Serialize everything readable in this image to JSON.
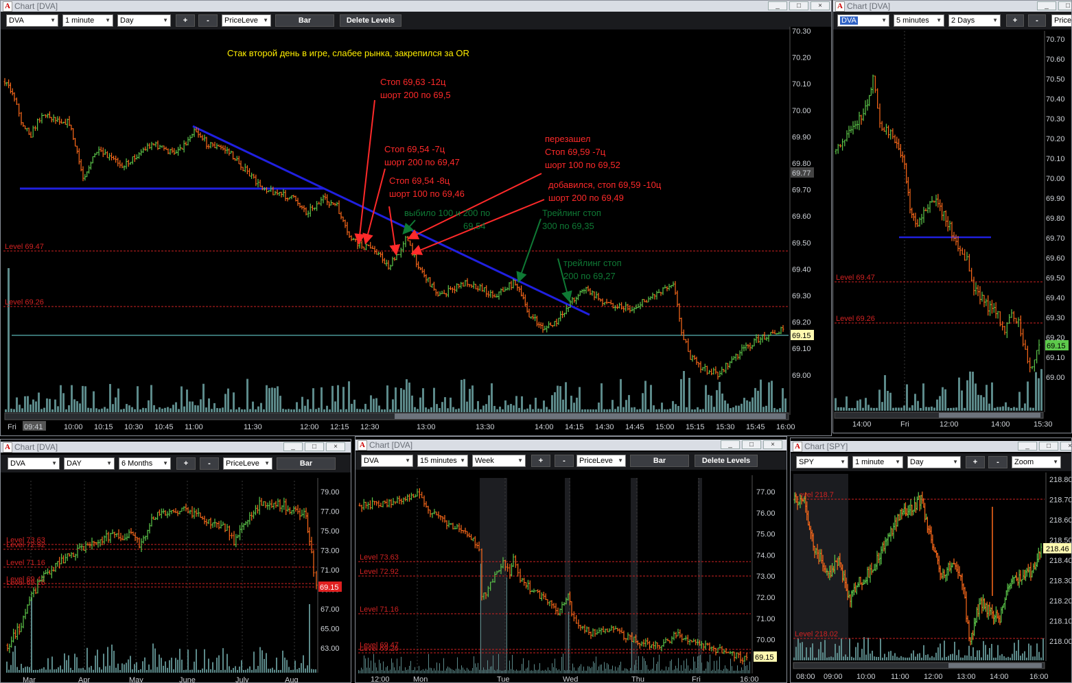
{
  "colors": {
    "up": "#5dc94b",
    "down": "#ff6a1a",
    "level": "#d02222",
    "trend": "#2020e0",
    "cyan": "#6fe3e3",
    "volume": "#5c8a8a"
  },
  "main": {
    "title": "Chart [DVA]",
    "win_buttons": [
      "_",
      "□",
      "×"
    ],
    "toolbar": {
      "symbol": "DVA",
      "interval": "1 minute",
      "range": "Day",
      "plus": "+",
      "minus": "-",
      "indicator": "PriceLeve",
      "bar": "Bar",
      "delete": "Delete Levels"
    },
    "price_axis": [
      "70.30",
      "70.20",
      "70.10",
      "70.00",
      "69.90",
      "69.80",
      "69.70",
      "69.60",
      "69.50",
      "69.40",
      "69.30",
      "69.20",
      "69.10",
      "69.00"
    ],
    "time_axis": [
      "Fri",
      "09:41",
      "10:00",
      "10:15",
      "10:30",
      "10:45",
      "11:00",
      "11:30",
      "12:00",
      "12:15",
      "12:30",
      "13:00",
      "13:30",
      "14:00",
      "14:15",
      "14:30",
      "14:45",
      "15:00",
      "15:15",
      "15:30",
      "15:45",
      "16:00"
    ],
    "levels": [
      "Level 69.47",
      "Level 69.26"
    ],
    "price_labels": {
      "ref": "69.77",
      "last": "69.15"
    },
    "headline": "Стак второй день в игре, слабее рынка, закрепился за OR",
    "annotations": [
      {
        "lines": [
          "Стоп 69,63 -12ц",
          "шорт 200 по 69,5"
        ]
      },
      {
        "lines": [
          "Стоп 69,54 -7ц",
          "шорт 200 по 69,47"
        ]
      },
      {
        "lines": [
          "Стоп 69,54 -8ц",
          "шорт 100 по 69,46"
        ]
      },
      {
        "lines": [
          "перезашел",
          "Стоп 69,59 -7ц",
          "шорт 100 по 69,52"
        ]
      },
      {
        "lines": [
          "добавился, стоп 69,59 -10ц",
          "шорт 200 по 69,49"
        ]
      },
      {
        "lines": [
          "выбило 100 и 200 по",
          "69,54"
        ]
      },
      {
        "lines": [
          "Трейлинг стоп",
          "300 по 69,35"
        ]
      },
      {
        "lines": [
          "трейлинг стоп",
          "200 по 69,27"
        ]
      }
    ]
  },
  "tr": {
    "title": "Chart [DVA]",
    "toolbar": {
      "symbol": "DVA",
      "interval": "5 minutes",
      "range": "2 Days",
      "plus": "+",
      "minus": "-",
      "indicator": "Price"
    },
    "price_axis": [
      "70.70",
      "70.60",
      "70.50",
      "70.40",
      "70.30",
      "70.20",
      "70.10",
      "70.00",
      "69.90",
      "69.80",
      "69.70",
      "69.60",
      "69.50",
      "69.40",
      "69.30",
      "69.20",
      "69.10",
      "69.00"
    ],
    "time_axis": [
      "14:00",
      "Fri",
      "12:00",
      "14:00",
      "15:30"
    ],
    "levels": [
      "Level 69.47",
      "Level 69.26"
    ],
    "last": "69.15"
  },
  "bl": {
    "title": "Chart [DVA]",
    "toolbar": {
      "symbol": "DVA",
      "interval": "DAY",
      "range": "6 Months",
      "plus": "+",
      "minus": "-",
      "indicator": "PriceLeve",
      "bar": "Bar"
    },
    "price_axis": [
      "79.00",
      "77.00",
      "75.00",
      "73.00",
      "71.00",
      "69.00",
      "67.00",
      "65.00",
      "63.00"
    ],
    "time_axis": [
      "Mar",
      "Apr",
      "May",
      "June",
      "July",
      "Aug"
    ],
    "levels": [
      "Level 73.63",
      "Level 72.92",
      "Level 71.16",
      "Level 69.47",
      "Level 69.26"
    ],
    "last": "69.15"
  },
  "bm": {
    "title": "Chart [DVA]",
    "toolbar": {
      "symbol": "DVA",
      "interval": "15 minutes",
      "range": "Week",
      "plus": "+",
      "minus": "-",
      "indicator": "PriceLeve",
      "bar": "Bar",
      "delete": "Delete Levels"
    },
    "price_axis": [
      "77.00",
      "76.00",
      "75.00",
      "74.00",
      "73.00",
      "72.00",
      "71.00",
      "70.00"
    ],
    "time_axis": [
      "12:00",
      "Mon",
      "Tue",
      "Wed",
      "Thu",
      "Fri",
      "16:00"
    ],
    "levels": [
      "Level 73.63",
      "Level 72.92",
      "Level 71.16",
      "Level 69.47",
      "Level 69.26"
    ],
    "last": "69.15"
  },
  "br": {
    "title": "Chart [SPY]",
    "toolbar": {
      "symbol": "SPY",
      "interval": "1 minute",
      "range": "Day",
      "plus": "+",
      "minus": "-",
      "indicator": "Zoom"
    },
    "price_axis": [
      "218.80",
      "218.70",
      "218.60",
      "218.50",
      "218.40",
      "218.30",
      "218.20",
      "218.10",
      "218.00"
    ],
    "time_axis": [
      "08:00",
      "09:00",
      "10:00",
      "11:00",
      "12:00",
      "13:00",
      "14:00",
      "16:00"
    ],
    "levels": [
      "Level 218.7",
      "Level 218.02"
    ],
    "last": "218.46"
  }
}
